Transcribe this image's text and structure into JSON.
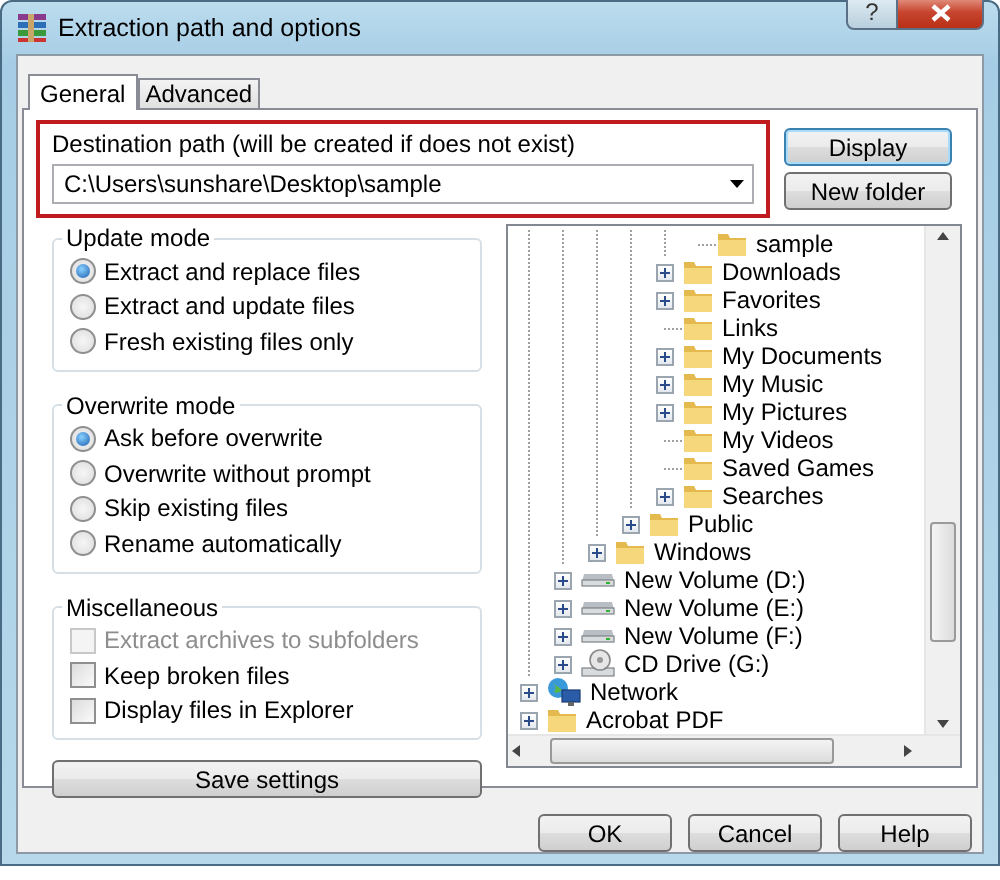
{
  "window": {
    "title": "Extraction path and options",
    "help_glyph": "?"
  },
  "tabs": [
    {
      "label": "General",
      "selected": true
    },
    {
      "label": "Advanced",
      "selected": false
    }
  ],
  "destination": {
    "label": "Destination path (will be created if does not exist)",
    "value": "C:\\Users\\sunshare\\Desktop\\sample"
  },
  "side_buttons": [
    {
      "label": "Display",
      "focused": true
    },
    {
      "label": "New folder",
      "focused": false
    }
  ],
  "groups": [
    {
      "title": "Update mode",
      "kind": "radio",
      "options": [
        {
          "label": "Extract and replace files",
          "selected": true
        },
        {
          "label": "Extract and update files",
          "selected": false
        },
        {
          "label": "Fresh existing files only",
          "selected": false
        }
      ]
    },
    {
      "title": "Overwrite mode",
      "kind": "radio",
      "options": [
        {
          "label": "Ask before overwrite",
          "selected": true
        },
        {
          "label": "Overwrite without prompt",
          "selected": false
        },
        {
          "label": "Skip existing files",
          "selected": false
        },
        {
          "label": "Rename automatically",
          "selected": false
        }
      ]
    },
    {
      "title": "Miscellaneous",
      "kind": "checkbox",
      "options": [
        {
          "label": "Extract archives to subfolders",
          "checked": false,
          "disabled": true
        },
        {
          "label": "Keep broken files",
          "checked": false,
          "disabled": false
        },
        {
          "label": "Display files in Explorer",
          "checked": false,
          "disabled": false
        }
      ]
    }
  ],
  "save_button": "Save settings",
  "tree": [
    {
      "children": [
        {
          "children": [
            {
              "children": [
                {
                  "children": [
                    {
                      "children": [
                        {
                          "label": "sample",
                          "kind": "folder",
                          "expandable": false
                        }
                      ]
                    },
                    {
                      "label": "Downloads",
                      "kind": "folder",
                      "expandable": true
                    },
                    {
                      "label": "Favorites",
                      "kind": "folder",
                      "expandable": true
                    },
                    {
                      "label": "Links",
                      "kind": "folder",
                      "expandable": false
                    },
                    {
                      "label": "My Documents",
                      "kind": "folder",
                      "expandable": true
                    },
                    {
                      "label": "My Music",
                      "kind": "folder",
                      "expandable": true
                    },
                    {
                      "label": "My Pictures",
                      "kind": "folder",
                      "expandable": true
                    },
                    {
                      "label": "My Videos",
                      "kind": "folder",
                      "expandable": false
                    },
                    {
                      "label": "Saved Games",
                      "kind": "folder",
                      "expandable": false
                    },
                    {
                      "label": "Searches",
                      "kind": "folder",
                      "expandable": true
                    }
                  ]
                },
                {
                  "label": "Public",
                  "kind": "folder",
                  "expandable": true
                }
              ]
            },
            {
              "label": "Windows",
              "kind": "folder",
              "expandable": true
            }
          ]
        },
        {
          "label": "New Volume (D:)",
          "kind": "drive",
          "expandable": true
        },
        {
          "label": "New Volume (E:)",
          "kind": "drive",
          "expandable": true
        },
        {
          "label": "New Volume (F:)",
          "kind": "drive",
          "expandable": true
        },
        {
          "label": "CD Drive (G:)",
          "kind": "disc",
          "expandable": true
        }
      ]
    },
    {
      "label": "Network",
      "kind": "network",
      "expandable": true
    },
    {
      "label": "Acrobat PDF",
      "kind": "folder",
      "expandable": true
    }
  ],
  "dialog_buttons": [
    "OK",
    "Cancel",
    "Help"
  ]
}
